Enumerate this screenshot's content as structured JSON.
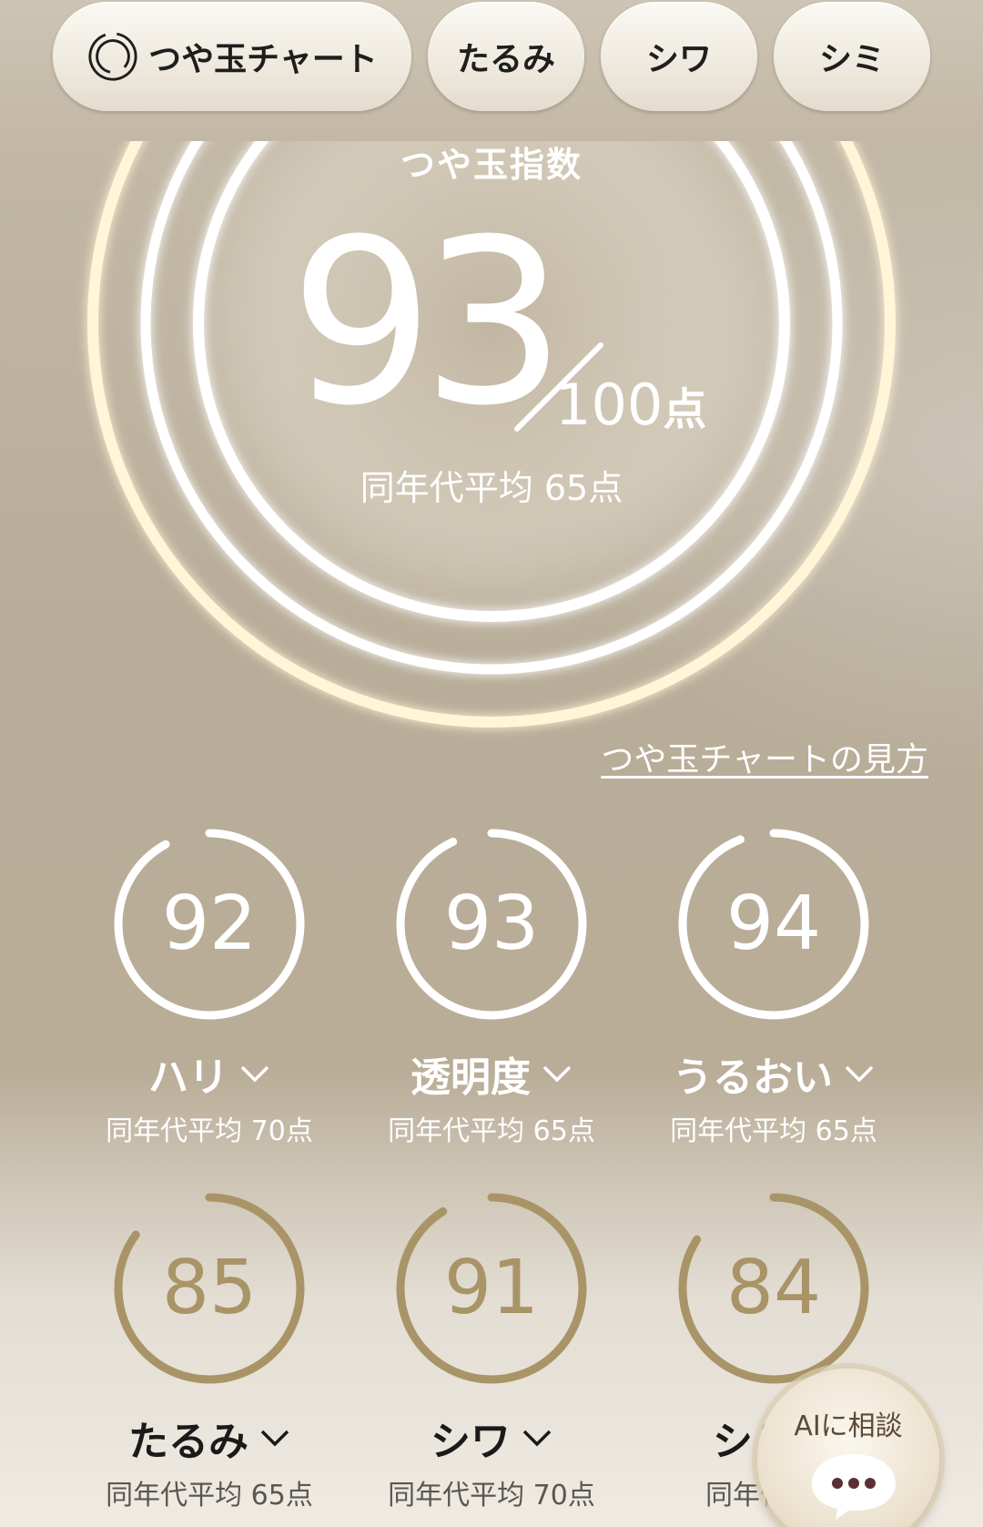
{
  "tabs": [
    {
      "label": "つや玉チャート",
      "active": true
    },
    {
      "label": "たるみ"
    },
    {
      "label": "シワ"
    },
    {
      "label": "シミ"
    }
  ],
  "hero": {
    "title": "つや玉指数",
    "score": "93",
    "max": "100",
    "unit": "点",
    "avg_text": "同年代平均 65点"
  },
  "guide_link": "つや玉チャートの見方",
  "metrics": [
    {
      "label": "ハリ",
      "value": 92,
      "avg": "同年代平均 70点"
    },
    {
      "label": "透明度",
      "value": 93,
      "avg": "同年代平均 65点"
    },
    {
      "label": "うるおい",
      "value": 94,
      "avg": "同年代平均 65点"
    },
    {
      "label": "たるみ",
      "value": 85,
      "avg": "同年代平均 65点"
    },
    {
      "label": "シワ",
      "value": 91,
      "avg": "同年代平均 70点"
    },
    {
      "label": "シミ",
      "value": 84,
      "avg": "同年代平均"
    }
  ],
  "ai_button": {
    "label": "AIに相談"
  },
  "colors": {
    "gauge_white": "#ffffff",
    "gauge_gold": "#a89466",
    "track_gold": "#e2d6bd"
  }
}
